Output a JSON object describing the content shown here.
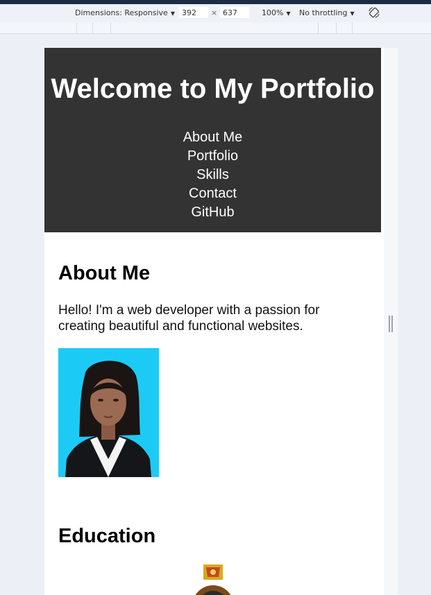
{
  "devtools": {
    "dimensions_label": "Dimensions: Responsive",
    "width_value": "392",
    "height_value": "637",
    "times_sign": "×",
    "zoom_label": "100%",
    "throttling_label": "No throttling"
  },
  "site": {
    "title": "Welcome to My Portfolio",
    "nav": [
      "About Me",
      "Portfolio",
      "Skills",
      "Contact",
      "GitHub"
    ],
    "about": {
      "heading": "About Me",
      "text": "Hello! I'm a web developer with a passion for creating beautiful and functional websites."
    },
    "education": {
      "heading": "Education"
    }
  },
  "colors": {
    "header_bg": "#333333",
    "page_bg": "#ecf0f6",
    "photo_bg": "#1ccbf5"
  }
}
